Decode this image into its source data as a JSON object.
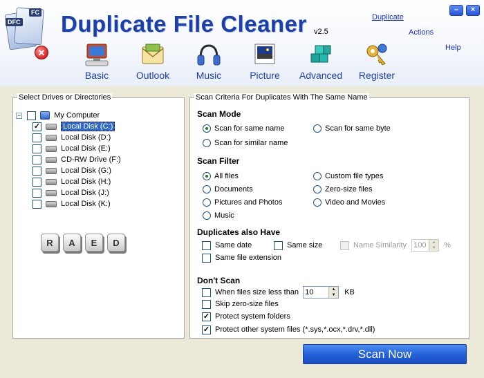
{
  "app": {
    "title": "Duplicate File Cleaner",
    "version": "v2.5",
    "logo_tag_1": "DFC",
    "logo_tag_2": "FC"
  },
  "top_menu": {
    "duplicate": "Duplicate",
    "actions": "Actions",
    "help": "Help"
  },
  "window_buttons": {
    "minimize": "–",
    "close": "×"
  },
  "toolbar": [
    {
      "label": "Basic",
      "icon": "computer-icon"
    },
    {
      "label": "Outlook",
      "icon": "envelope-icon"
    },
    {
      "label": "Music",
      "icon": "headphones-icon"
    },
    {
      "label": "Picture",
      "icon": "picture-icon"
    },
    {
      "label": "Advanced",
      "icon": "blocks-icon"
    },
    {
      "label": "Register",
      "icon": "key-icon"
    }
  ],
  "drives_panel": {
    "title": "Select Drives or Directories",
    "root": {
      "label": "My Computer",
      "checked": false
    },
    "drives": [
      {
        "label": "Local Disk (C:)",
        "checked": true
      },
      {
        "label": "Local Disk (D:)",
        "checked": false
      },
      {
        "label": "Local Disk (E:)",
        "checked": false
      },
      {
        "label": "CD-RW Drive (F:)",
        "checked": false
      },
      {
        "label": "Local Disk (G:)",
        "checked": false
      },
      {
        "label": "Local Disk (H:)",
        "checked": false
      },
      {
        "label": "Local Disk (J:)",
        "checked": false
      },
      {
        "label": "Local Disk (K:)",
        "checked": false
      }
    ],
    "keys": [
      "R",
      "A",
      "E",
      "D"
    ]
  },
  "criteria_panel": {
    "title": "Scan Criteria For Duplicates With The Same Name",
    "scan_mode": {
      "heading": "Scan Mode",
      "same_name": "Scan for same name",
      "same_byte": "Scan for same byte",
      "similar_name": "Scan for similar name"
    },
    "scan_filter": {
      "heading": "Scan Filter",
      "all_files": "All files",
      "custom": "Custom file types",
      "documents": "Documents",
      "zero_size": "Zero-size files",
      "pictures": "Pictures and Photos",
      "video": "Video and Movies",
      "music": "Music"
    },
    "duplicates_also": {
      "heading": "Duplicates also Have",
      "same_date": "Same date",
      "same_size": "Same size",
      "name_similarity": "Name Similarity",
      "similarity_value": "100",
      "similarity_unit": "%",
      "same_ext": "Same file extension"
    },
    "dont_scan": {
      "heading": "Don't Scan",
      "size_less": "When files size less than",
      "size_value": "10",
      "size_unit": "KB",
      "skip_zero": "Skip zero-size files",
      "protect_folders": "Protect system folders",
      "protect_files": "Protect other system files (*.sys,*.ocx,*.drv,*.dll)"
    }
  },
  "scan_button": "Scan Now"
}
